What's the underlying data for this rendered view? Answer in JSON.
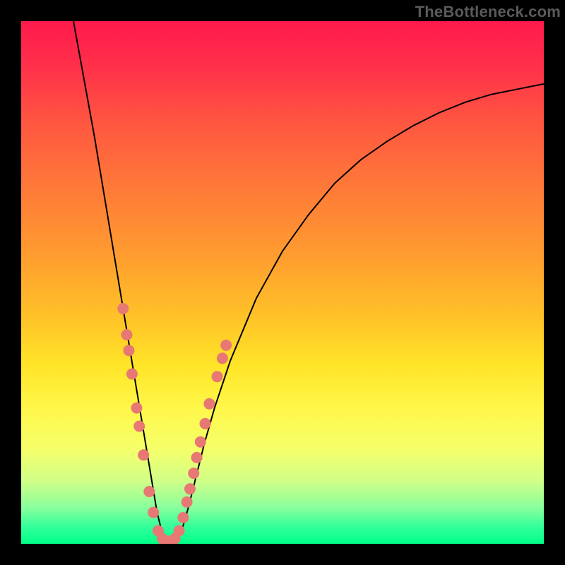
{
  "watermark": "TheBottleneck.com",
  "colors": {
    "frame": "#000000",
    "marker": "#e77874",
    "curve": "#000000"
  },
  "chart_data": {
    "type": "line",
    "title": "",
    "xlabel": "",
    "ylabel": "",
    "xlim": [
      0,
      100
    ],
    "ylim": [
      0,
      100
    ],
    "grid": false,
    "legend": "none",
    "description": "Single V-shaped curve over a vertical red→green gradient. Left arm descends steeply to a trough near x≈26, right arm rises with decreasing slope toward the right edge. Salmon circular markers cluster along both arms just above and around the trough.",
    "series": [
      {
        "name": "curve",
        "x": [
          10,
          12,
          14,
          16,
          18,
          19,
          20,
          21,
          22,
          23,
          24,
          25,
          26,
          27,
          28,
          29,
          30,
          31,
          32,
          33,
          34,
          35,
          37,
          40,
          45,
          50,
          55,
          60,
          65,
          70,
          75,
          80,
          85,
          90,
          95,
          100
        ],
        "y": [
          100,
          89,
          78,
          66,
          54,
          48,
          42,
          36,
          30,
          24,
          18,
          12,
          6,
          2,
          0.5,
          0,
          1,
          3.5,
          7,
          11,
          15,
          19,
          26,
          35,
          47,
          56,
          63,
          69,
          73.5,
          77,
          80,
          82.5,
          84.5,
          86,
          87,
          88
        ]
      }
    ],
    "markers": [
      {
        "x": 19.5,
        "y": 45
      },
      {
        "x": 20.2,
        "y": 40
      },
      {
        "x": 20.6,
        "y": 37
      },
      {
        "x": 21.2,
        "y": 32.5
      },
      {
        "x": 22.1,
        "y": 26
      },
      {
        "x": 22.6,
        "y": 22.5
      },
      {
        "x": 23.4,
        "y": 17
      },
      {
        "x": 24.5,
        "y": 10
      },
      {
        "x": 25.3,
        "y": 6
      },
      {
        "x": 26.2,
        "y": 2.5
      },
      {
        "x": 27.0,
        "y": 1
      },
      {
        "x": 27.8,
        "y": 0.5
      },
      {
        "x": 28.6,
        "y": 0.5
      },
      {
        "x": 29.4,
        "y": 1
      },
      {
        "x": 30.2,
        "y": 2.5
      },
      {
        "x": 31.0,
        "y": 5
      },
      {
        "x": 31.7,
        "y": 8
      },
      {
        "x": 32.3,
        "y": 10.5
      },
      {
        "x": 33.0,
        "y": 13.5
      },
      {
        "x": 33.6,
        "y": 16.5
      },
      {
        "x": 34.3,
        "y": 19.5
      },
      {
        "x": 35.2,
        "y": 23
      },
      {
        "x": 36.0,
        "y": 26.8
      },
      {
        "x": 37.5,
        "y": 32
      },
      {
        "x": 38.5,
        "y": 35.5
      },
      {
        "x": 39.2,
        "y": 38
      }
    ]
  }
}
